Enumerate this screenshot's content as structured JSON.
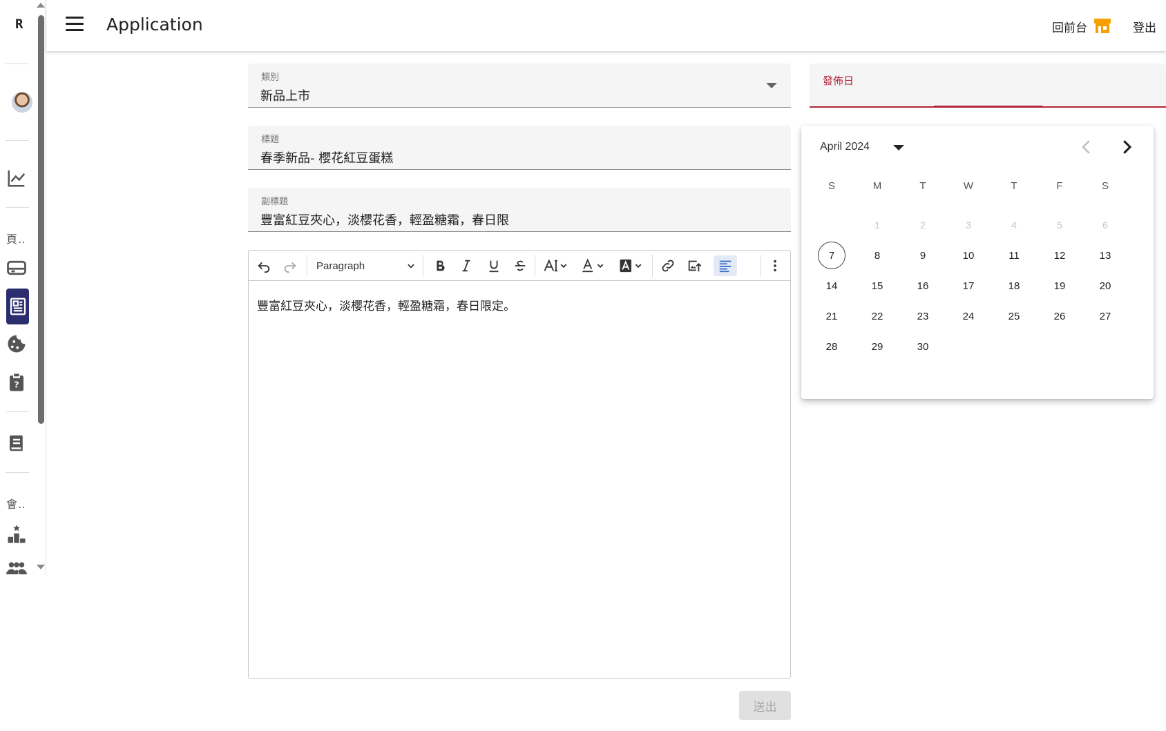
{
  "rail": {
    "logo": "R",
    "text_item_1": "頁‥",
    "text_item_2": "會‥"
  },
  "header": {
    "title": "Application",
    "back_to_frontend": "回前台",
    "logout": "登出"
  },
  "form": {
    "category": {
      "label": "類別",
      "value": "新品上市"
    },
    "title": {
      "label": "標題",
      "value": "春季新品- 櫻花紅豆蛋糕"
    },
    "subtitle": {
      "label": "副標題",
      "value": "豐富紅豆夾心，淡櫻花香，輕盈糖霜，春日限"
    },
    "publish_date": {
      "label": "發佈日"
    },
    "submit_label": "送出"
  },
  "editor": {
    "block_format": "Paragraph",
    "content": "豐富紅豆夾心，淡櫻花香，輕盈糖霜，春日限定。"
  },
  "calendar": {
    "month_label": "April 2024",
    "weekday_headers": [
      "S",
      "M",
      "T",
      "W",
      "T",
      "F",
      "S"
    ],
    "disabled_days": [
      "1",
      "2",
      "3",
      "4",
      "5",
      "6"
    ],
    "today": "7",
    "days": [
      "7",
      "8",
      "9",
      "10",
      "11",
      "12",
      "13",
      "14",
      "15",
      "16",
      "17",
      "18",
      "19",
      "20",
      "21",
      "22",
      "23",
      "24",
      "25",
      "26",
      "27",
      "28",
      "29",
      "30"
    ]
  },
  "colors": {
    "accent_red": "#b2243b",
    "rail_active": "#2a2e6e",
    "shop_icon": "#f5a000"
  }
}
